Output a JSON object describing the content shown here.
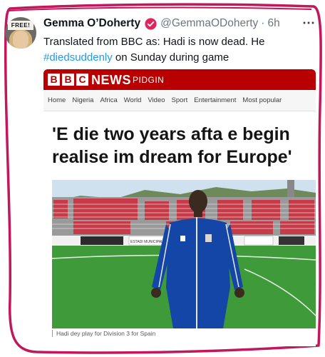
{
  "tweet": {
    "display_name": "Gemma O’Doherty",
    "handle": "@GemmaODoherty",
    "separator": "·",
    "time": "6h",
    "more": "⋯",
    "avatar_badge": "FREE!",
    "text_part1": "Translated from BBC as: Hadi is now dead. He ",
    "hashtag": "#diedsuddenly",
    "text_part2": " on Sunday during game"
  },
  "bbc": {
    "logo_letters": [
      "B",
      "B",
      "C"
    ],
    "news_label": "NEWS",
    "edition": "PIDGIN",
    "nav": [
      "Home",
      "Nigeria",
      "Africa",
      "World",
      "Video",
      "Sport",
      "Entertainment",
      "Most popular"
    ],
    "headline": "'E die two years afta e begin realise im dream for Europe'",
    "stadium_sign_1": "ESTADI MUNICIPAL LA FLORESTA",
    "caption": "Hadi dey play for Division 3 for Spain"
  },
  "colors": {
    "bbc_red": "#b80000",
    "outline_magenta": "#c2185b",
    "hashtag_blue": "#1d9bf0",
    "verified_red": "#e0245e",
    "jersey_blue": "#1446a8"
  }
}
